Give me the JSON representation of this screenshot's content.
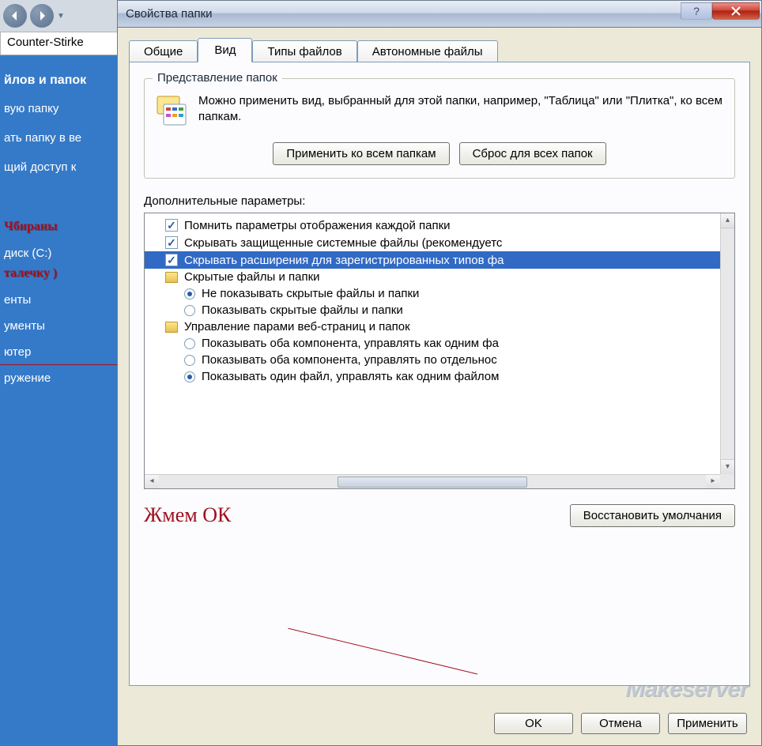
{
  "explorer": {
    "address": "Counter-Stirke",
    "panel_header": "йлов и папок",
    "links": [
      "вую папку",
      "ать папку в ве",
      "щий доступ к"
    ],
    "tree_items": [
      "диск (C:)",
      "енты",
      "ументы",
      "ютер",
      "ружение"
    ],
    "red1": "Чбираны",
    "red2": "талечку )"
  },
  "dialog": {
    "title": "Свойства папки",
    "tabs": {
      "general": "Общие",
      "view": "Вид",
      "filetypes": "Типы файлов",
      "offline": "Автономные файлы"
    },
    "groupbox": {
      "title": "Представление папок",
      "text": "Можно применить вид, выбранный для этой папки, например, \"Таблица\" или \"Плитка\", ко всем папкам.",
      "apply_all": "Применить ко всем папкам",
      "reset_all": "Сброс для всех папок"
    },
    "advanced": {
      "label": "Дополнительные параметры:",
      "items": [
        {
          "type": "check",
          "checked": true,
          "text": "Помнить параметры отображения каждой папки",
          "indent": 1
        },
        {
          "type": "check",
          "checked": true,
          "text": "Скрывать защищенные системные файлы (рекомендуетс",
          "indent": 1
        },
        {
          "type": "check",
          "checked": true,
          "text": "Скрывать расширения для зарегистрированных типов фа",
          "indent": 1,
          "selected": true
        },
        {
          "type": "folder",
          "text": "Скрытые файлы и папки",
          "indent": 1
        },
        {
          "type": "radio",
          "checked": true,
          "text": "Не показывать скрытые файлы и папки",
          "indent": 2
        },
        {
          "type": "radio",
          "checked": false,
          "text": "Показывать скрытые файлы и папки",
          "indent": 2
        },
        {
          "type": "folder",
          "text": "Управление парами веб-страниц и папок",
          "indent": 1
        },
        {
          "type": "radio",
          "checked": false,
          "text": "Показывать оба компонента, управлять как одним фа",
          "indent": 2
        },
        {
          "type": "radio",
          "checked": false,
          "text": "Показывать оба компонента, управлять по отдельнос",
          "indent": 2
        },
        {
          "type": "radio",
          "checked": true,
          "text": "Показывать один файл, управлять как одним файлом",
          "indent": 2
        }
      ]
    },
    "restore": "Восстановить умолчания",
    "annotation": "Жмем ОК",
    "ok": "OK",
    "cancel": "Отмена",
    "apply": "Применить"
  },
  "watermark": "Makeserver"
}
